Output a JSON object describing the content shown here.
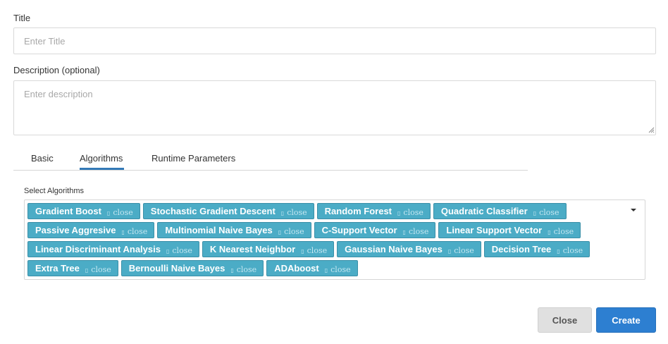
{
  "form": {
    "title_label": "Title",
    "title_placeholder": "Enter Title",
    "title_value": "",
    "description_label": "Description (optional)",
    "description_placeholder": "Enter description",
    "description_value": ""
  },
  "tabs": [
    {
      "label": "Basic",
      "active": false
    },
    {
      "label": "Algorithms",
      "active": true
    },
    {
      "label": "Runtime Parameters",
      "active": false
    }
  ],
  "algorithms": {
    "label": "Select Algorithms",
    "close_text": "close",
    "close_glyph": "▯",
    "chip_color": "#4bacc6",
    "selected": [
      "Gradient Boost",
      "Stochastic Gradient Descent",
      "Random Forest",
      "Quadratic Classifier",
      "Passive Aggresive",
      "Multinomial Naive Bayes",
      "C-Support Vector",
      "Linear Support Vector",
      "Linear Discriminant Analysis",
      "K Nearest Neighbor",
      "Gaussian Naive Bayes",
      "Decision Tree",
      "Extra Tree",
      "Bernoulli Naive Bayes",
      "ADAboost"
    ]
  },
  "footer": {
    "close_label": "Close",
    "create_label": "Create",
    "create_color": "#2d7fd1"
  }
}
